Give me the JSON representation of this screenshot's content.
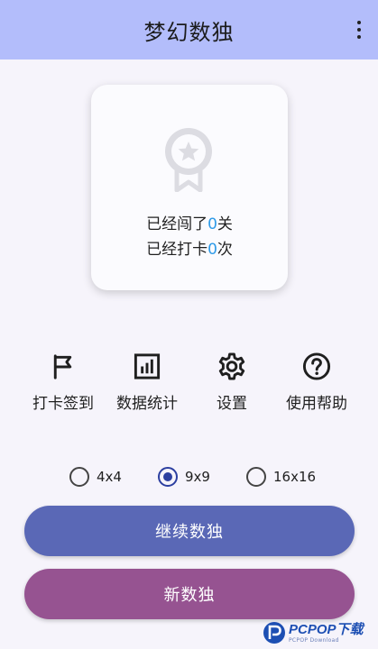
{
  "app_bar": {
    "title": "梦幻数独",
    "menu_icon": "more-vert-icon"
  },
  "stats_card": {
    "icon": "medal-icon",
    "line1": {
      "prefix": "已经闯了",
      "value": "0",
      "suffix": "关"
    },
    "line2": {
      "prefix": "已经打卡",
      "value": "0",
      "suffix": "次"
    },
    "value_color": "#2f9be8"
  },
  "actions": [
    {
      "icon": "flag-icon",
      "label": "打卡签到"
    },
    {
      "icon": "bar-chart-icon",
      "label": "数据统计"
    },
    {
      "icon": "gear-icon",
      "label": "设置"
    },
    {
      "icon": "help-icon",
      "label": "使用帮助"
    }
  ],
  "grid_size": {
    "options": [
      "4x4",
      "9x9",
      "16x16"
    ],
    "selected": "9x9"
  },
  "buttons": {
    "continue_label": "继续数独",
    "new_label": "新数独"
  },
  "watermark": {
    "main": "PCPOP下载",
    "sub": "PCPOP Download"
  },
  "colors": {
    "app_bar": "#b3bdfb",
    "background": "#f6f4fb",
    "continue_button": "#5a68b6",
    "new_button": "#965391",
    "radio_selected": "#2c3fa0"
  }
}
